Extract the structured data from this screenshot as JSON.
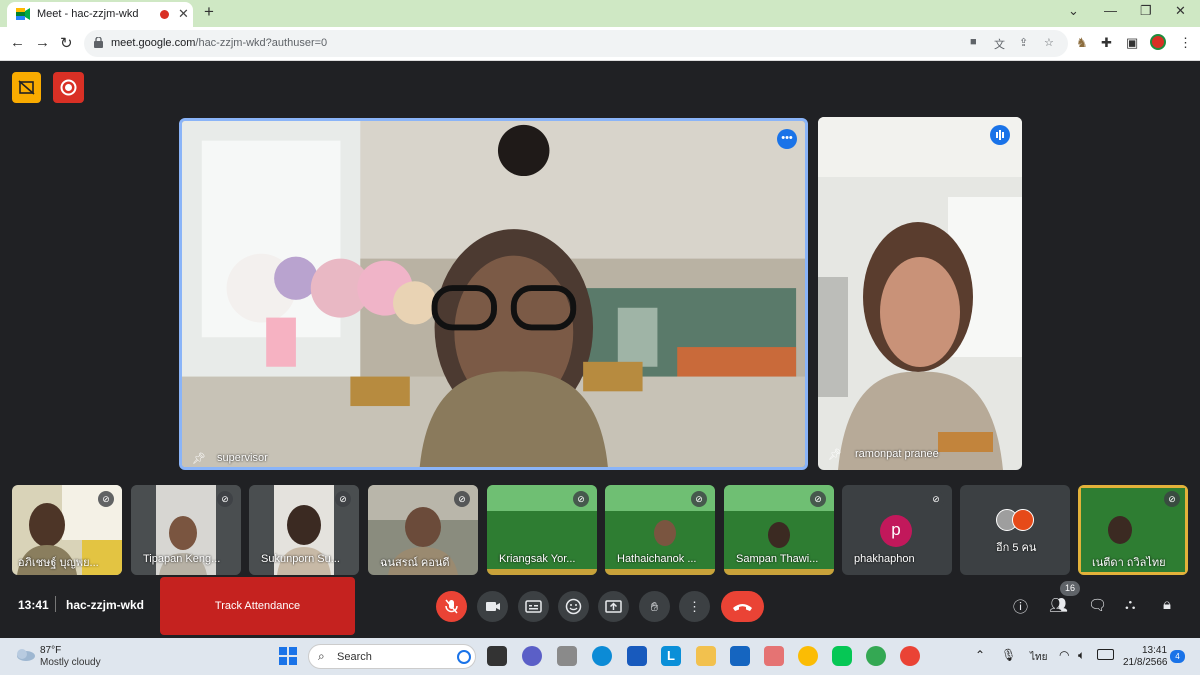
{
  "browser": {
    "tab_title": "Meet - hac-zzjm-wkd",
    "new_tab": "+",
    "url_host": "meet.google.com",
    "url_path": "/hac-zzjm-wkd?authuser=0",
    "window_controls": [
      "⌄",
      "—",
      "❐",
      "✕"
    ]
  },
  "meeting": {
    "time": "13:41",
    "code": "hac-zzjm-wkd",
    "track_attendance": "Track Attendance",
    "participant_count": "16"
  },
  "main_tiles": [
    {
      "name": "supervisor",
      "pinned": true,
      "accent": "#8ab4f8"
    },
    {
      "name": "ramonpat pranee",
      "pinned": true
    }
  ],
  "strip_tiles": [
    {
      "name": "อภิเชษฐ์ บุญพย..."
    },
    {
      "name": "Tipapan Keng..."
    },
    {
      "name": "Sukunporn Su..."
    },
    {
      "name": "ฉนสรณ์ คอนดี"
    },
    {
      "name": "Kriangsak Yor..."
    },
    {
      "name": "Hathaichanok ..."
    },
    {
      "name": "Sampan Thawi..."
    },
    {
      "name": "phakhaphon",
      "avatar_letter": "p",
      "avatar_color": "#c2185b"
    },
    {
      "name": "อีก 5 คน"
    },
    {
      "name": "เนตีดา ถวิลไทย"
    }
  ],
  "taskbar": {
    "temperature": "87°F",
    "weather": "Mostly cloudy",
    "search_label": "Search",
    "language": "ไทย",
    "time": "13:41",
    "date": "21/8/2566",
    "notifications": "4"
  },
  "colors": {
    "meet_bg": "#202124",
    "tile_bg": "#3c4043",
    "danger": "#ea4335",
    "track_button": "#c5221f",
    "tab_strip": "#cfe8c4"
  }
}
